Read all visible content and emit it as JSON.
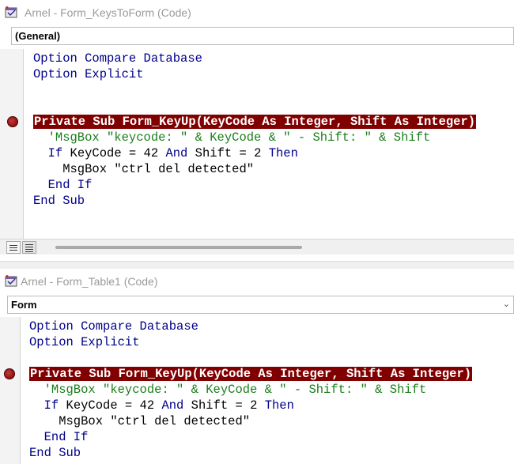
{
  "windows": [
    {
      "title": "Arnel - Form_KeysToForm (Code)",
      "object_combo": "(General)",
      "code_lines": [
        {
          "parts": [
            {
              "t": "Option Compare Database",
              "c": "kw"
            }
          ]
        },
        {
          "parts": [
            {
              "t": "Option Explicit",
              "c": "kw"
            }
          ]
        },
        {
          "parts": []
        },
        {
          "parts": []
        },
        {
          "breakpoint": true,
          "parts": [
            {
              "t": "Private Sub Form_KeyUp(KeyCode As Integer, Shift As Integer)",
              "c": "bp"
            }
          ]
        },
        {
          "parts": [
            {
              "t": "  'MsgBox \"keycode: \" & KeyCode & \" - Shift: \" & Shift",
              "c": "cmt"
            }
          ]
        },
        {
          "parts": [
            {
              "t": "  ",
              "c": "txt"
            },
            {
              "t": "If",
              "c": "kw"
            },
            {
              "t": " KeyCode = 42 ",
              "c": "txt"
            },
            {
              "t": "And",
              "c": "kw"
            },
            {
              "t": " Shift = 2 ",
              "c": "txt"
            },
            {
              "t": "Then",
              "c": "kw"
            }
          ]
        },
        {
          "parts": [
            {
              "t": "    MsgBox \"ctrl del detected\"",
              "c": "txt"
            }
          ]
        },
        {
          "parts": [
            {
              "t": "  End If",
              "c": "kw"
            }
          ]
        },
        {
          "parts": [
            {
              "t": "End Sub",
              "c": "kw"
            }
          ]
        }
      ]
    },
    {
      "title": "Arnel - Form_Table1 (Code)",
      "object_combo": "Form",
      "code_lines": [
        {
          "parts": [
            {
              "t": "Option Compare Database",
              "c": "kw"
            }
          ]
        },
        {
          "parts": [
            {
              "t": "Option Explicit",
              "c": "kw"
            }
          ]
        },
        {
          "parts": []
        },
        {
          "breakpoint": true,
          "parts": [
            {
              "t": "Private Sub Form_KeyUp(KeyCode As Integer, Shift As Integer)",
              "c": "bp"
            }
          ]
        },
        {
          "parts": [
            {
              "t": "  'MsgBox \"keycode: \" & KeyCode & \" - Shift: \" & Shift",
              "c": "cmt"
            }
          ]
        },
        {
          "parts": [
            {
              "t": "  ",
              "c": "txt"
            },
            {
              "t": "If",
              "c": "kw"
            },
            {
              "t": " KeyCode = 42 ",
              "c": "txt"
            },
            {
              "t": "And",
              "c": "kw"
            },
            {
              "t": " Shift = 2 ",
              "c": "txt"
            },
            {
              "t": "Then",
              "c": "kw"
            }
          ]
        },
        {
          "parts": [
            {
              "t": "    MsgBox \"ctrl del detected\"",
              "c": "txt"
            }
          ]
        },
        {
          "parts": [
            {
              "t": "  End If",
              "c": "kw"
            }
          ]
        },
        {
          "parts": [
            {
              "t": "End Sub",
              "c": "kw"
            }
          ]
        }
      ]
    }
  ],
  "colors": {
    "keyword": "#00008b",
    "comment": "#1a7f1a",
    "breakpoint_bg": "#800000",
    "breakpoint_text": "#ffffff"
  }
}
